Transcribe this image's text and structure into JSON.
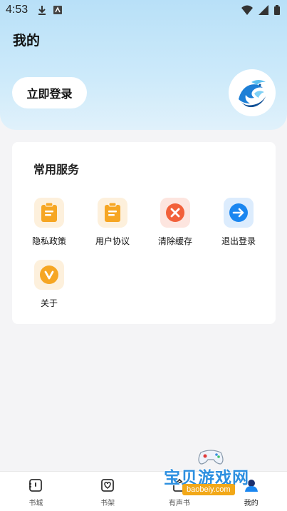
{
  "status_bar": {
    "time": "4:53"
  },
  "header": {
    "title": "我的",
    "login_label": "立即登录"
  },
  "services": {
    "title": "常用服务",
    "items": [
      {
        "label": "隐私政策",
        "icon": "document-icon",
        "color": "#f6a623",
        "bg": "#fdf0dc"
      },
      {
        "label": "用户协议",
        "icon": "document-icon",
        "color": "#f6a623",
        "bg": "#fdf0dc"
      },
      {
        "label": "清除缓存",
        "icon": "close-circle-icon",
        "color": "#f2603a",
        "bg": "#fde5df"
      },
      {
        "label": "退出登录",
        "icon": "arrow-right-circle-icon",
        "color": "#1a86f0",
        "bg": "#dcecfd"
      },
      {
        "label": "关于",
        "icon": "chevron-v-icon",
        "color": "#f6a623",
        "bg": "#fdf0dc"
      }
    ]
  },
  "nav": {
    "items": [
      {
        "label": "书城",
        "icon": "bookstore-icon"
      },
      {
        "label": "书架",
        "icon": "bookshelf-icon"
      },
      {
        "label": "有声书",
        "icon": "audiobook-icon"
      },
      {
        "label": "我的",
        "icon": "profile-icon",
        "active": true
      }
    ]
  },
  "watermark": {
    "title": "宝贝游戏网",
    "url": "baobeiy.com"
  }
}
